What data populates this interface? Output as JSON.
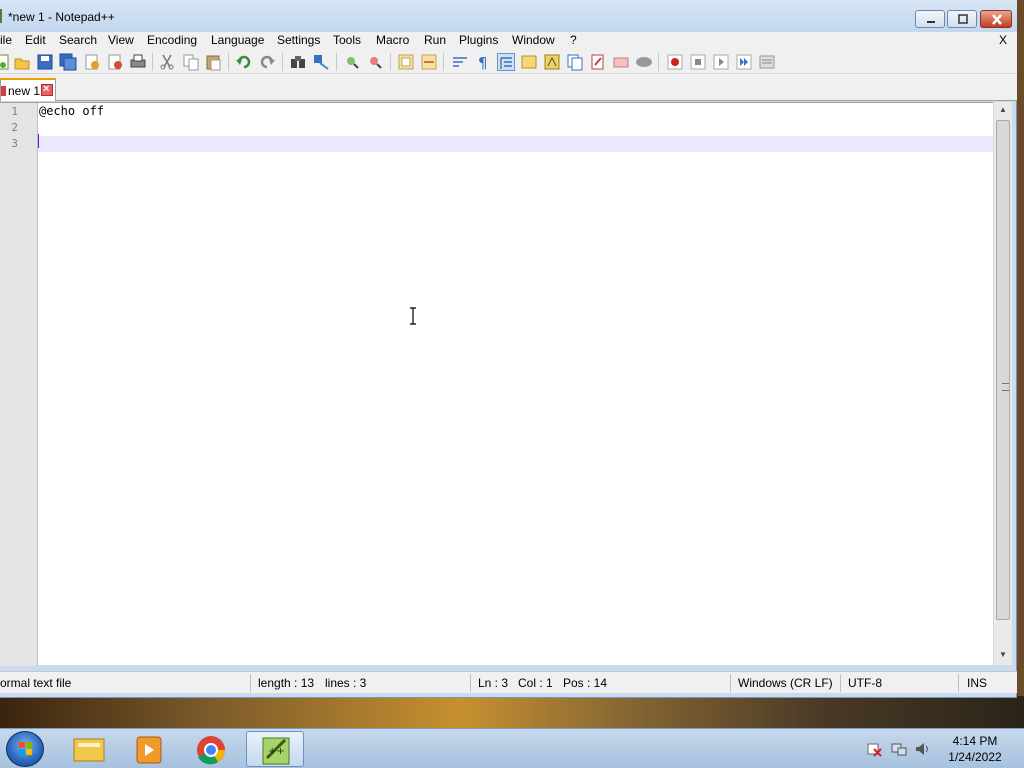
{
  "window": {
    "title": "*new 1 - Notepad++"
  },
  "menu": {
    "items": [
      "ile",
      "Edit",
      "Search",
      "View",
      "Encoding",
      "Language",
      "Settings",
      "Tools",
      "Macro",
      "Run",
      "Plugins",
      "Window",
      "?"
    ],
    "close": "X"
  },
  "tabs": [
    {
      "label": "new 1"
    }
  ],
  "editor": {
    "line_numbers": [
      "1",
      "2",
      "3"
    ],
    "lines": [
      "@echo off",
      "",
      ""
    ],
    "current_line": 3
  },
  "status": {
    "file_type": "ormal text file",
    "length": "length : 13",
    "lines": "lines : 3",
    "ln": "Ln : 3",
    "col": "Col : 1",
    "pos": "Pos : 14",
    "eol": "Windows (CR LF)",
    "encoding": "UTF-8",
    "mode": "INS"
  },
  "taskbar": {
    "apps": [
      "windows-explorer-icon",
      "media-player-icon",
      "chrome-icon",
      "notepadpp-icon"
    ],
    "time": "4:14 PM",
    "date": "1/24/2022"
  }
}
